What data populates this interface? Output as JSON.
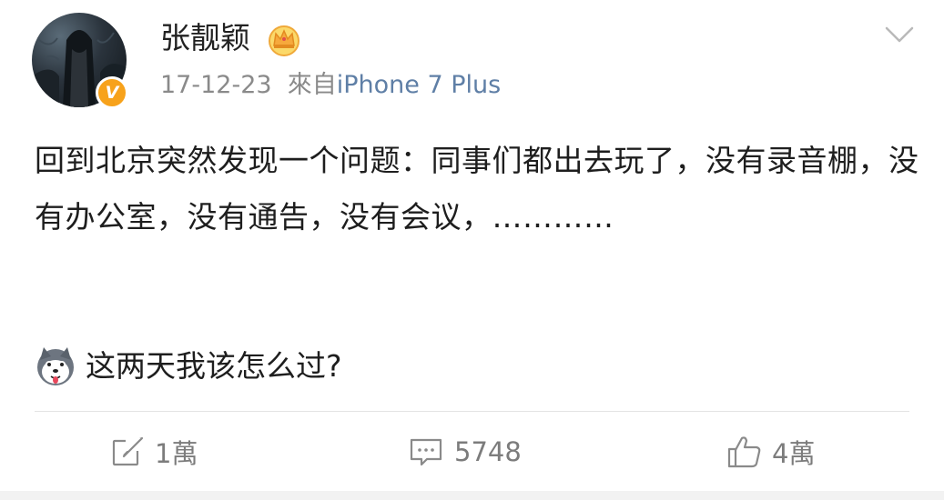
{
  "post": {
    "author": "张靓颖",
    "timestamp": "17-12-23",
    "source_prefix": "來自",
    "source_device": "iPhone 7 Plus",
    "text_main": "回到北京突然发现一个问题：同事们都出去玩了，没有录音棚，没有办公室，没有通告，没有会议，…………",
    "text_question": "这两天我该怎么过?",
    "verified_badge": "V",
    "avatar_icon": "avatar-image",
    "crown_icon": "vip-crown-icon",
    "emoji_icon": "husky-dog-emoji"
  },
  "actions": {
    "repost": "1萬",
    "comments": "5748",
    "likes": "4萬"
  },
  "colors": {
    "text": "#1e1e1e",
    "meta": "#8a8a8a",
    "source": "#5f7fa6",
    "badge": "#f7a21b",
    "action": "#7c7c7c"
  }
}
